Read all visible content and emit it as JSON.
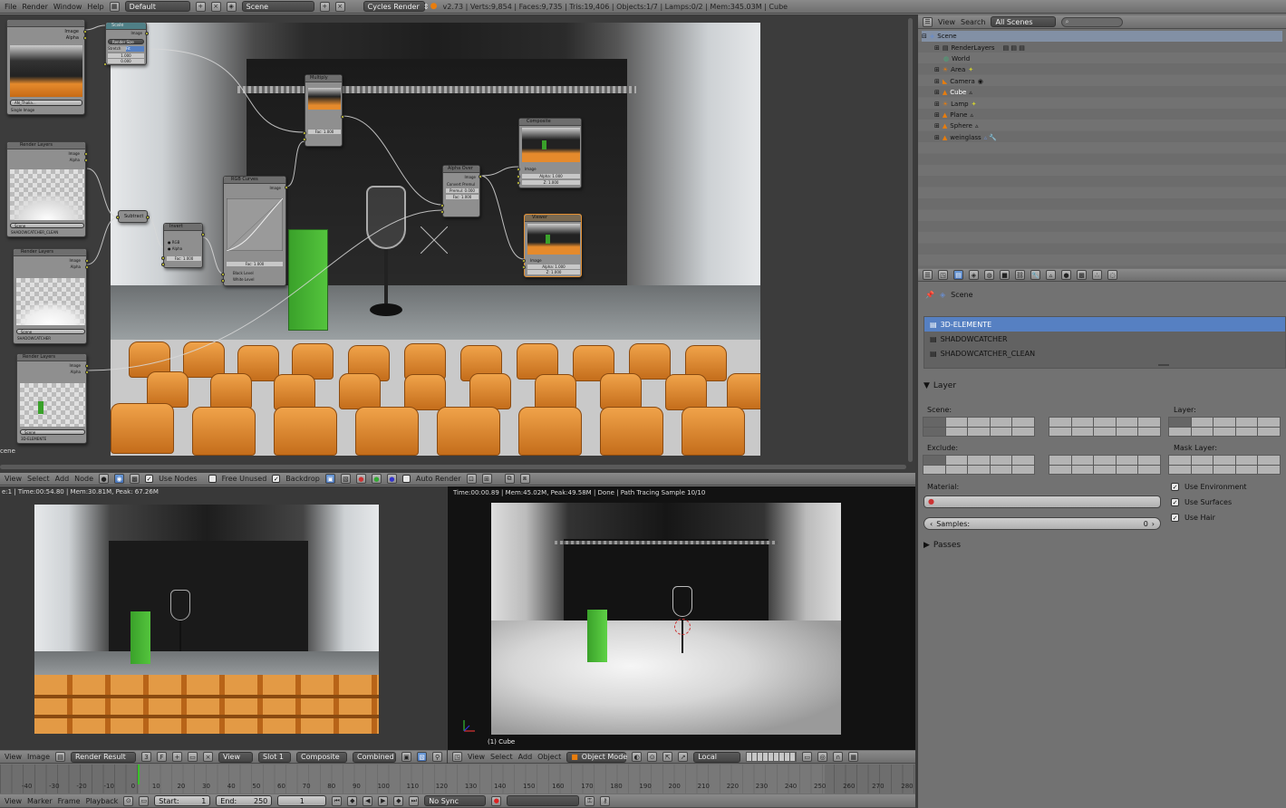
{
  "topbar": {
    "menus": [
      "File",
      "Render",
      "Window",
      "Help"
    ],
    "layout": "Default",
    "scene": "Scene",
    "engine": "Cycles Render",
    "stats": "v2.73 | Verts:9,854 | Faces:9,735 | Tris:19,406 | Objects:1/7 | Lamps:0/2 | Mem:345.03M | Cube"
  },
  "node_editor": {
    "menus": [
      "View",
      "Select",
      "Add",
      "Node"
    ],
    "use_nodes": "Use Nodes",
    "free_unused": "Free Unused",
    "backdrop": "Backdrop",
    "auto_render": "Auto Render",
    "left_edge_label": "cene",
    "nodes": {
      "image_node": {
        "out1": "Image",
        "out2": "Alpha",
        "frame": "Single Image",
        "file": "AN_Thalia..."
      },
      "render_layers_1": {
        "title": "Render Layers",
        "out1": "Image",
        "out2": "Alpha",
        "scene": "Scene",
        "layer": "SHADOWCATCHER_CLEAN"
      },
      "render_layers_2": {
        "title": "Render Layers",
        "out1": "Image",
        "out2": "Alpha",
        "scene": "Scene",
        "layer": "SHADOWCATCHER"
      },
      "render_layers_3": {
        "title": "Render Layers",
        "out1": "Image",
        "out2": "Alpha",
        "scene": "Scene",
        "layer": "3D-ELEMENTE"
      },
      "scale": {
        "title": "Scale",
        "out1": "Image",
        "mode": "Render Size",
        "btn1": "Stretch",
        "btn2": "Fit",
        "x": "1.000",
        "y": "0.000"
      },
      "subtract": {
        "title": "Subtract"
      },
      "invert": {
        "title": "Invert",
        "fac": "Fac: 1.000"
      },
      "rgb_curves": {
        "title": "RGB Curves",
        "out1": "Image",
        "in_black": "Black Level",
        "in_white": "White Level",
        "fac": "Fac: 1.000"
      },
      "multiply": {
        "title": "Multiply",
        "fac": "Fac: 1.000"
      },
      "alpha_over": {
        "title": "Alpha Over",
        "out1": "Image",
        "convert": "Convert Premul",
        "premul": "Premul: 0.000",
        "fac": "Fac: 1.000"
      },
      "composite": {
        "title": "Composite",
        "in1": "Image",
        "alpha": "Alpha: 1.000",
        "z": "Z: 1.000"
      },
      "viewer": {
        "title": "Viewer",
        "in1": "Image",
        "alpha": "Alpha: 1.000",
        "z": "Z: 1.000"
      }
    }
  },
  "image_editor": {
    "status": "e:1 | Time:00:54.80 | Mem:30.81M, Peak: 67.26M",
    "menus": [
      "View",
      "Image"
    ],
    "image": "Render Result",
    "image_users": "3",
    "fake_user": "F",
    "view": "View",
    "slot": "Slot 1",
    "composite": "Composite",
    "pass": "Combined"
  },
  "viewport": {
    "status": "Time:00:00.89 | Mem:45.02M, Peak:49.58M | Done | Path Tracing Sample 10/10",
    "object_label": "(1) Cube",
    "menus": [
      "View",
      "Select",
      "Add",
      "Object"
    ],
    "mode": "Object Mode",
    "pivot": "Local"
  },
  "timeline": {
    "ticks": [
      "-40",
      "-30",
      "-20",
      "-10",
      "0",
      "10",
      "20",
      "30",
      "40",
      "50",
      "60",
      "70",
      "80",
      "90",
      "100",
      "110",
      "120",
      "130",
      "140",
      "150",
      "160",
      "170",
      "180",
      "190",
      "200",
      "210",
      "220",
      "230",
      "240",
      "250",
      "260",
      "270",
      "280"
    ],
    "menus": [
      "View",
      "Marker",
      "Frame",
      "Playback"
    ],
    "start": "Start:",
    "start_val": "1",
    "end": "End:",
    "end_val": "250",
    "current": "1",
    "sync": "No Sync"
  },
  "outliner": {
    "menus": [
      "View",
      "Search"
    ],
    "display": "All Scenes",
    "items": [
      "Scene",
      "RenderLayers",
      "World",
      "Area",
      "Camera",
      "Cube",
      "Lamp",
      "Plane",
      "Sphere",
      "weinglass"
    ]
  },
  "properties": {
    "context": "Scene",
    "layers": [
      "3D-ELEMENTE",
      "SHADOWCATCHER",
      "SHADOWCATCHER_CLEAN"
    ],
    "layer_panel": "Layer",
    "scene_label": "Scene:",
    "layer_label": "Layer:",
    "exclude_label": "Exclude:",
    "mask_label": "Mask Layer:",
    "material_label": "Material:",
    "samples_label": "Samples:",
    "samples_value": "0",
    "use_environment": "Use Environment",
    "use_surfaces": "Use Surfaces",
    "use_hair": "Use Hair",
    "passes_panel": "Passes"
  },
  "colors": {
    "accent": "#5680c2",
    "node_selected": "#e38f31",
    "socket": "#ccc933"
  }
}
